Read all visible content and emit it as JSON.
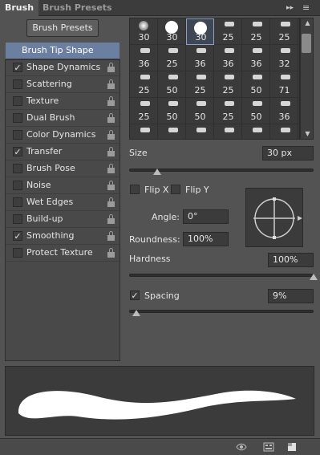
{
  "tabs": [
    {
      "label": "Brush",
      "active": true
    },
    {
      "label": "Brush Presets",
      "active": false
    }
  ],
  "header_icons": {
    "collapse": "▸▸",
    "menu": "≡"
  },
  "left": {
    "preset_button": "Brush Presets",
    "options": [
      {
        "label": "Brush Tip Shape",
        "checked": null,
        "selected": true,
        "lock": false
      },
      {
        "label": "Shape Dynamics",
        "checked": true,
        "selected": false,
        "lock": true
      },
      {
        "label": "Scattering",
        "checked": false,
        "selected": false,
        "lock": true
      },
      {
        "label": "Texture",
        "checked": false,
        "selected": false,
        "lock": true
      },
      {
        "label": "Dual Brush",
        "checked": false,
        "selected": false,
        "lock": true
      },
      {
        "label": "Color Dynamics",
        "checked": false,
        "selected": false,
        "lock": true
      },
      {
        "label": "Transfer",
        "checked": true,
        "selected": false,
        "lock": true
      },
      {
        "label": "Brush Pose",
        "checked": false,
        "selected": false,
        "lock": true
      },
      {
        "label": "Noise",
        "checked": false,
        "selected": false,
        "lock": true
      },
      {
        "label": "Wet Edges",
        "checked": false,
        "selected": false,
        "lock": true
      },
      {
        "label": "Build-up",
        "checked": false,
        "selected": false,
        "lock": true
      },
      {
        "label": "Smoothing",
        "checked": true,
        "selected": false,
        "lock": true
      },
      {
        "label": "Protect Texture",
        "checked": false,
        "selected": false,
        "lock": true
      }
    ]
  },
  "brush_grid": {
    "selected_index": 2,
    "rows": [
      [
        "30",
        "30",
        "30",
        "25",
        "25",
        "25"
      ],
      [
        "36",
        "25",
        "36",
        "36",
        "36",
        "32"
      ],
      [
        "25",
        "50",
        "25",
        "25",
        "50",
        "71"
      ],
      [
        "25",
        "50",
        "50",
        "25",
        "50",
        "36"
      ],
      [
        "",
        "",
        "",
        "",
        "",
        ""
      ]
    ]
  },
  "size": {
    "label": "Size",
    "value": "30 px",
    "fraction": 0.15
  },
  "flip": {
    "x_label": "Flip X",
    "y_label": "Flip Y",
    "x_checked": false,
    "y_checked": false
  },
  "angle": {
    "label": "Angle:",
    "value": "0°"
  },
  "roundness": {
    "label": "Roundness:",
    "value": "100%"
  },
  "hardness": {
    "label": "Hardness",
    "value": "100%",
    "fraction": 1.0
  },
  "spacing": {
    "label": "Spacing",
    "value": "9%",
    "checked": true,
    "fraction": 0.04
  },
  "check_glyph": "✓",
  "scroll_arrows": {
    "up": "▲",
    "down": "▼"
  }
}
